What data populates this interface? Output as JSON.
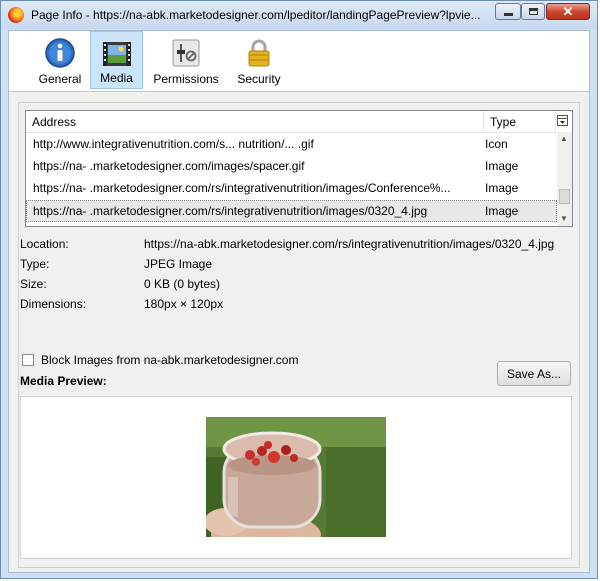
{
  "window": {
    "title": "Page Info - https://na-abk.marketodesigner.com/lpeditor/landingPagePreview?lpvie...",
    "close_glyph": "✕"
  },
  "toolbar": {
    "tabs": [
      {
        "label": "General",
        "icon": "info-icon"
      },
      {
        "label": "Media",
        "icon": "media-icon",
        "selected": true
      },
      {
        "label": "Permissions",
        "icon": "permissions-icon"
      },
      {
        "label": "Security",
        "icon": "lock-icon"
      }
    ]
  },
  "media_list": {
    "columns": [
      "Address",
      "Type"
    ],
    "rows": [
      {
        "address": "http://www.integrativenutrition.com/s...            nutrition/...  .gif",
        "type": "Icon"
      },
      {
        "address": "https://na-        .marketodesigner.com/images/spacer.gif",
        "type": "Image"
      },
      {
        "address": "https://na-        .marketodesigner.com/rs/integrativenutrition/images/Conference%...",
        "type": "Image"
      },
      {
        "address": "https://na-        .marketodesigner.com/rs/integrativenutrition/images/0320_4.jpg",
        "type": "Image",
        "selected": true
      }
    ]
  },
  "details": {
    "location_label": "Location:",
    "location_value": "https://na-abk.marketodesigner.com/rs/integrativenutrition/images/0320_4.jpg",
    "type_label": "Type:",
    "type_value": "JPEG Image",
    "size_label": "Size:",
    "size_value": "0 KB (0 bytes)",
    "dimensions_label": "Dimensions:",
    "dimensions_value": "180px × 120px"
  },
  "block_images": {
    "label": "Block Images from na-abk.marketodesigner.com",
    "checked": false
  },
  "preview": {
    "label": "Media Preview:",
    "save_as_label": "Save As..."
  }
}
